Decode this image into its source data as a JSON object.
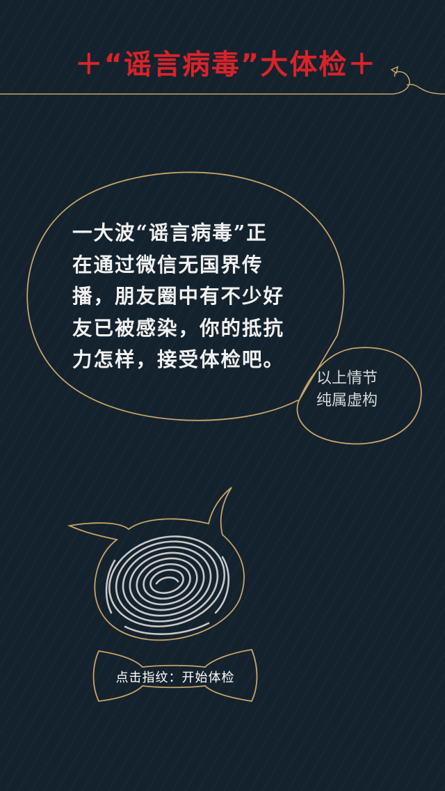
{
  "header": {
    "title": "＋“谣言病毒”大体检＋"
  },
  "bubble": {
    "lines": [
      "一大波“谣言病毒”正",
      "在通过微信无国界传",
      "播，朋友圈中有不少好",
      "友已被感染，你的抵抗",
      "力怎样，接受体检吧。"
    ]
  },
  "disclaimer": {
    "lines": [
      "以上情节",
      "纯属虚构"
    ]
  },
  "fingerprint": {
    "icon": "fingerprint-icon"
  },
  "start_button": {
    "label": "点击指纹：开始体检"
  },
  "colors": {
    "background": "#14222d",
    "accent_red": "#d9232a",
    "outline_gold": "#c8a46a",
    "fingerprint": "#c9c9c9"
  }
}
